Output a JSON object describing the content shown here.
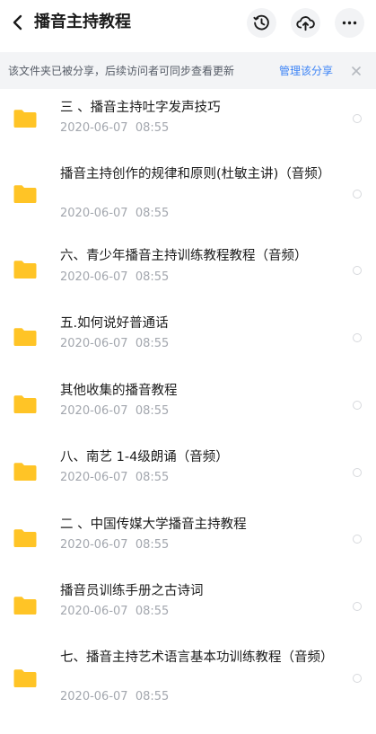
{
  "header": {
    "title": "播音主持教程",
    "icons": [
      "back-icon",
      "history-icon",
      "cloud-upload-icon",
      "more-icon"
    ]
  },
  "banner": {
    "text": "该文件夹已被分享，后续访问者可同步查看更新",
    "manage_label": "管理该分享",
    "close_icon": "close-icon",
    "link_color": "#3d84f6"
  },
  "folder_color": "#ffc426",
  "files": [
    {
      "name": "三 、播音主持吐字发声技巧",
      "date": "2020-06-07  08:55"
    },
    {
      "name": "播音主持创作的规律和原则(杜敏主讲)（音频）",
      "date": "2020-06-07  08:55"
    },
    {
      "name": "六、青少年播音主持训练教程教程（音频）",
      "date": "2020-06-07  08:55"
    },
    {
      "name": "五.如何说好普通话",
      "date": "2020-06-07  08:55"
    },
    {
      "name": "其他收集的播音教程",
      "date": "2020-06-07  08:55"
    },
    {
      "name": "八、南艺 1-4级朗诵（音频）",
      "date": "2020-06-07  08:55"
    },
    {
      "name": "二 、中国传媒大学播音主持教程",
      "date": "2020-06-07  08:55"
    },
    {
      "name": "播音员训练手册之古诗词",
      "date": "2020-06-07  08:55"
    },
    {
      "name": "七、播音主持艺术语言基本功训练教程（音频）",
      "date": "2020-06-07  08:55"
    }
  ]
}
